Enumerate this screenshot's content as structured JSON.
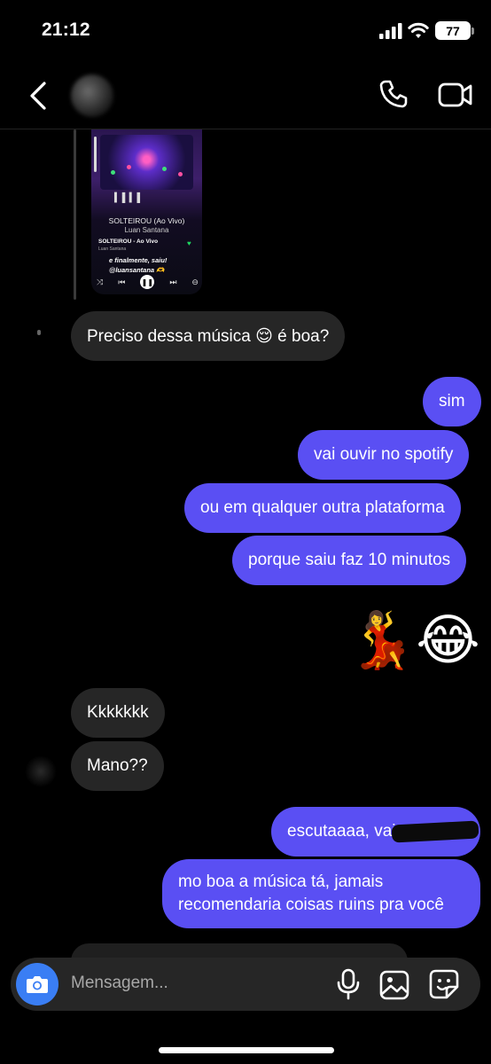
{
  "status": {
    "time": "21:12",
    "battery": "77"
  },
  "header": {
    "contact_name": ""
  },
  "story": {
    "brand": "SOLTEIROU",
    "eq": "▍▌▍▌",
    "title": "SOLTEIROU (Ao Vivo)",
    "artist": "Luan Santana",
    "track": "SOLTEIROU - Ao Vivo",
    "track_artist": "Luan Santana",
    "caption": "e finalmente, saiu! @luansantana 🫶"
  },
  "messages": {
    "m1": "Preciso dessa música 😌 é boa?",
    "m2": "sim",
    "m3": "vai ouvir no spotify",
    "m4": "ou em qualquer outra plataforma",
    "m5": "porque saiu faz 10 minutos",
    "m6": "💃😂",
    "m7": "Kkkkkkk",
    "m8": "Mano??",
    "m9": "escutaaaa, vai",
    "m10": "mo boa a música tá, jamais recomendaria coisas ruins pra você"
  },
  "composer": {
    "placeholder": "Mensagem..."
  },
  "colors": {
    "outgoing": "#5a4ff3",
    "incoming": "#262626",
    "camera": "#3a7ef4"
  }
}
